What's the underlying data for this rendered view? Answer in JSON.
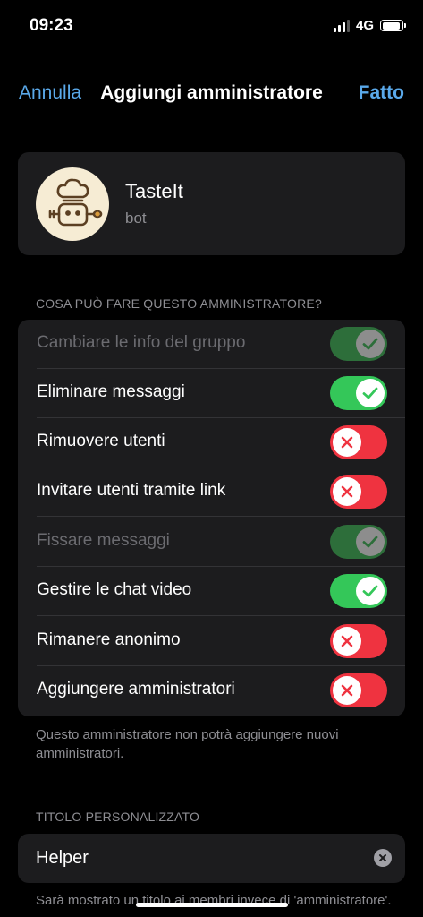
{
  "status_bar": {
    "time": "09:23",
    "network": "4G"
  },
  "nav": {
    "cancel_label": "Annulla",
    "title": "Aggiungi amministratore",
    "done_label": "Fatto"
  },
  "bot": {
    "name": "TasteIt",
    "subtitle": "bot"
  },
  "permissions": {
    "header": "COSA PUÒ FARE QUESTO AMMINISTRATORE?",
    "items": [
      {
        "label": "Cambiare le info del gruppo",
        "state": "on",
        "enabled": false
      },
      {
        "label": "Eliminare messaggi",
        "state": "on",
        "enabled": true
      },
      {
        "label": "Rimuovere utenti",
        "state": "off",
        "enabled": true
      },
      {
        "label": "Invitare utenti tramite link",
        "state": "off",
        "enabled": true
      },
      {
        "label": "Fissare messaggi",
        "state": "on",
        "enabled": false
      },
      {
        "label": "Gestire le chat video",
        "state": "on",
        "enabled": true
      },
      {
        "label": "Rimanere anonimo",
        "state": "off",
        "enabled": true
      },
      {
        "label": "Aggiungere amministratori",
        "state": "off",
        "enabled": true
      }
    ],
    "footer": "Questo amministratore non potrà aggiungere nuovi amministratori."
  },
  "custom_title": {
    "header": "TITOLO PERSONALIZZATO",
    "value": "Helper",
    "footer": "Sarà mostrato un titolo ai membri invece di 'amministratore'."
  },
  "colors": {
    "accent": "#5aa9ea",
    "toggle_on": "#34c759",
    "toggle_off": "#ef3340",
    "toggle_disabled": "#2d6e3a",
    "card": "#1c1c1e"
  }
}
